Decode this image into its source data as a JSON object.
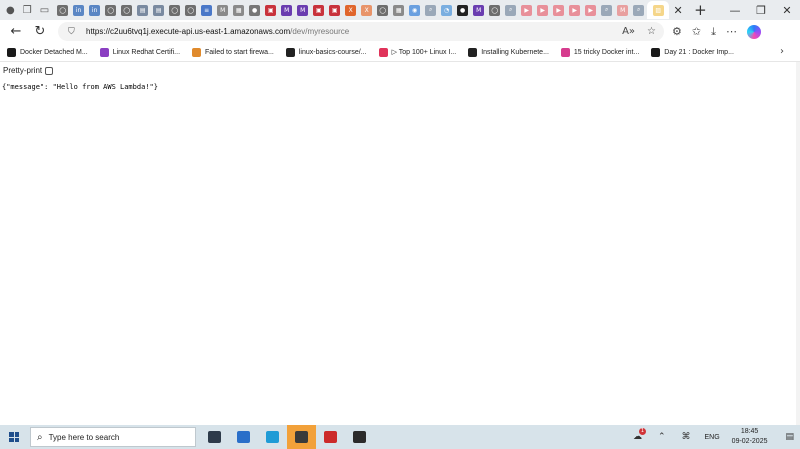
{
  "browser": {
    "tabs": [
      {
        "name": "tab-github-1",
        "color": "#6e6e6e",
        "glyph": "◯"
      },
      {
        "name": "tab-linkedin-1",
        "color": "#5a86c4",
        "glyph": "in"
      },
      {
        "name": "tab-linkedin-2",
        "color": "#5a86c4",
        "glyph": "in"
      },
      {
        "name": "tab-github-2",
        "color": "#6e6e6e",
        "glyph": "◯"
      },
      {
        "name": "tab-github-3",
        "color": "#6e6e6e",
        "glyph": "◯"
      },
      {
        "name": "tab-docs-1",
        "color": "#7a8aa0",
        "glyph": "▤"
      },
      {
        "name": "tab-docs-2",
        "color": "#7a8aa0",
        "glyph": "▤"
      },
      {
        "name": "tab-github-4",
        "color": "#6e6e6e",
        "glyph": "◯"
      },
      {
        "name": "tab-github-5",
        "color": "#6e6e6e",
        "glyph": "◯"
      },
      {
        "name": "tab-stack-1",
        "color": "#4a78c8",
        "glyph": "≡"
      },
      {
        "name": "tab-mail-1",
        "color": "#8a8a8a",
        "glyph": "M"
      },
      {
        "name": "tab-doc-1",
        "color": "#8a8a8a",
        "glyph": "▦"
      },
      {
        "name": "tab-circle-1",
        "color": "#777777",
        "glyph": "●"
      },
      {
        "name": "tab-red-1",
        "color": "#c8323c",
        "glyph": "▣"
      },
      {
        "name": "tab-purple-1",
        "color": "#6a3db0",
        "glyph": "M"
      },
      {
        "name": "tab-purple-2",
        "color": "#6a3db0",
        "glyph": "M"
      },
      {
        "name": "tab-red-2",
        "color": "#c8323c",
        "glyph": "▣"
      },
      {
        "name": "tab-red-3",
        "color": "#c8323c",
        "glyph": "▣"
      },
      {
        "name": "tab-orange-1",
        "color": "#e0662d",
        "glyph": "X"
      },
      {
        "name": "tab-orange-2",
        "color": "#e8946a",
        "glyph": "X"
      },
      {
        "name": "tab-github-6",
        "color": "#6e6e6e",
        "glyph": "◯"
      },
      {
        "name": "tab-doc-2",
        "color": "#8a8a8a",
        "glyph": "▦"
      },
      {
        "name": "tab-blue-1",
        "color": "#6aa0e0",
        "glyph": "◉"
      },
      {
        "name": "tab-search-1",
        "color": "#9aa8b8",
        "glyph": "⌕"
      },
      {
        "name": "tab-blue-2",
        "color": "#7aaee0",
        "glyph": "◔"
      },
      {
        "name": "tab-black-1",
        "color": "#222222",
        "glyph": "●"
      },
      {
        "name": "tab-purple-3",
        "color": "#6a3db0",
        "glyph": "M"
      },
      {
        "name": "tab-github-7",
        "color": "#6e6e6e",
        "glyph": "◯"
      },
      {
        "name": "tab-search-2",
        "color": "#9aa8b8",
        "glyph": "⌕"
      },
      {
        "name": "tab-youtube-1",
        "color": "#e8909a",
        "glyph": "▶"
      },
      {
        "name": "tab-youtube-2",
        "color": "#e8909a",
        "glyph": "▶"
      },
      {
        "name": "tab-youtube-3",
        "color": "#e8909a",
        "glyph": "▶"
      },
      {
        "name": "tab-youtube-4",
        "color": "#e8909a",
        "glyph": "▶"
      },
      {
        "name": "tab-youtube-5",
        "color": "#e8909a",
        "glyph": "▶"
      },
      {
        "name": "tab-search-3",
        "color": "#9aa8b8",
        "glyph": "⌕"
      },
      {
        "name": "tab-gmail-1",
        "color": "#e8a0a0",
        "glyph": "M"
      },
      {
        "name": "tab-search-4",
        "color": "#9aa8b8",
        "glyph": "⌕"
      },
      {
        "name": "tab-aws-active",
        "color": "#f5d68a",
        "glyph": "▨"
      }
    ],
    "active_tab_close": "✕",
    "new_tab": "+",
    "window_controls": {
      "minimize": "—",
      "restore": "❐",
      "close": "✕"
    },
    "nav": {
      "back": "←",
      "refresh": "↻"
    },
    "address": {
      "host": "https://c2uu6tvq1j.execute-api.us-east-1.amazonaws.com",
      "path": "/dev/myresource"
    },
    "favorites": [
      {
        "name": "fav-docker-detached",
        "label": "Docker Detached M...",
        "color": "#1a1a1a"
      },
      {
        "name": "fav-linux-redhat",
        "label": "Linux Redhat Certifi...",
        "color": "#8b3fc2"
      },
      {
        "name": "fav-failed-firewall",
        "label": "Failed to start firewa...",
        "color": "#e08a2c"
      },
      {
        "name": "fav-linux-basics",
        "label": "linux-basics-course/...",
        "color": "#222222"
      },
      {
        "name": "fav-top-100-linux",
        "label": "▷ Top 100+ Linux I...",
        "color": "#e0335a"
      },
      {
        "name": "fav-installing-kubernetes",
        "label": "Installing Kubernete...",
        "color": "#222222"
      },
      {
        "name": "fav-15-tricky-docker",
        "label": "15 tricky Docker int...",
        "color": "#d63c8e"
      },
      {
        "name": "fav-day-21-docker",
        "label": "Day 21 : Docker Imp...",
        "color": "#1a1a1a"
      }
    ],
    "favorites_more": "›"
  },
  "page": {
    "pretty_print_label": "Pretty-print",
    "body": "{\"message\": \"Hello from AWS Lambda!\"}"
  },
  "taskbar": {
    "search_placeholder": "Type here to search",
    "apps": [
      {
        "name": "task-view",
        "color": "#2d3a4a"
      },
      {
        "name": "microsoft-store",
        "color": "#2a6fc9"
      },
      {
        "name": "edge-browser",
        "color": "#1f9bd6"
      },
      {
        "name": "sticky-notes",
        "color": "#3a3a3a",
        "active": true
      },
      {
        "name": "acrobat-reader",
        "color": "#cc2a2a"
      },
      {
        "name": "terminal",
        "color": "#2b2b2b"
      }
    ],
    "notification_count": "1",
    "language": "ENG",
    "time": "18:45",
    "date": "09-02-2025"
  }
}
